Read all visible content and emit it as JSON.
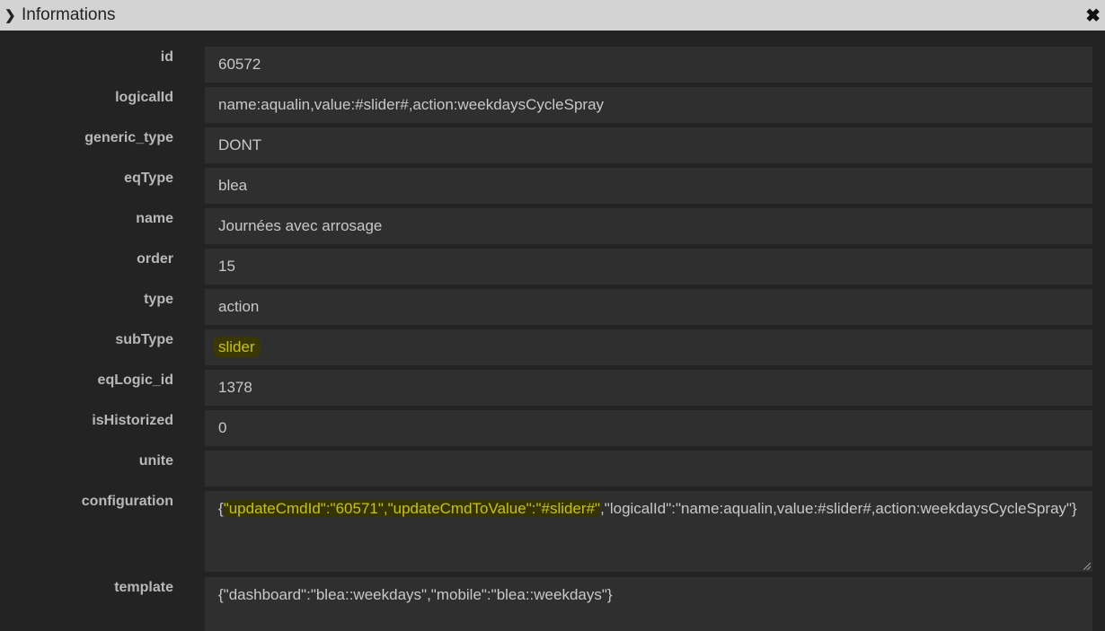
{
  "header": {
    "title": "Informations"
  },
  "fields": [
    {
      "label": "id",
      "value": "60572"
    },
    {
      "label": "logicalId",
      "value": "name:aqualin,value:#slider#,action:weekdaysCycleSpray"
    },
    {
      "label": "generic_type",
      "value": "DONT"
    },
    {
      "label": "eqType",
      "value": "blea"
    },
    {
      "label": "name",
      "value": "Journées avec arrosage"
    },
    {
      "label": "order",
      "value": "15"
    },
    {
      "label": "type",
      "value": "action"
    },
    {
      "label": "subType",
      "value": "slider"
    },
    {
      "label": "eqLogic_id",
      "value": "1378"
    },
    {
      "label": "isHistorized",
      "value": "0"
    },
    {
      "label": "unite",
      "value": ""
    }
  ],
  "configuration": {
    "label": "configuration",
    "prefix": "{",
    "highlight": "\"updateCmdId\":\"60571\",\"updateCmdToValue\":\"#slider#\"",
    "suffix": ",\"logicalId\":\"name:aqualin,value:#slider#,action:weekdaysCycleSpray\"}"
  },
  "template": {
    "label": "template",
    "value": "{\"dashboard\":\"blea::weekdays\",\"mobile\":\"blea::weekdays\"}"
  }
}
